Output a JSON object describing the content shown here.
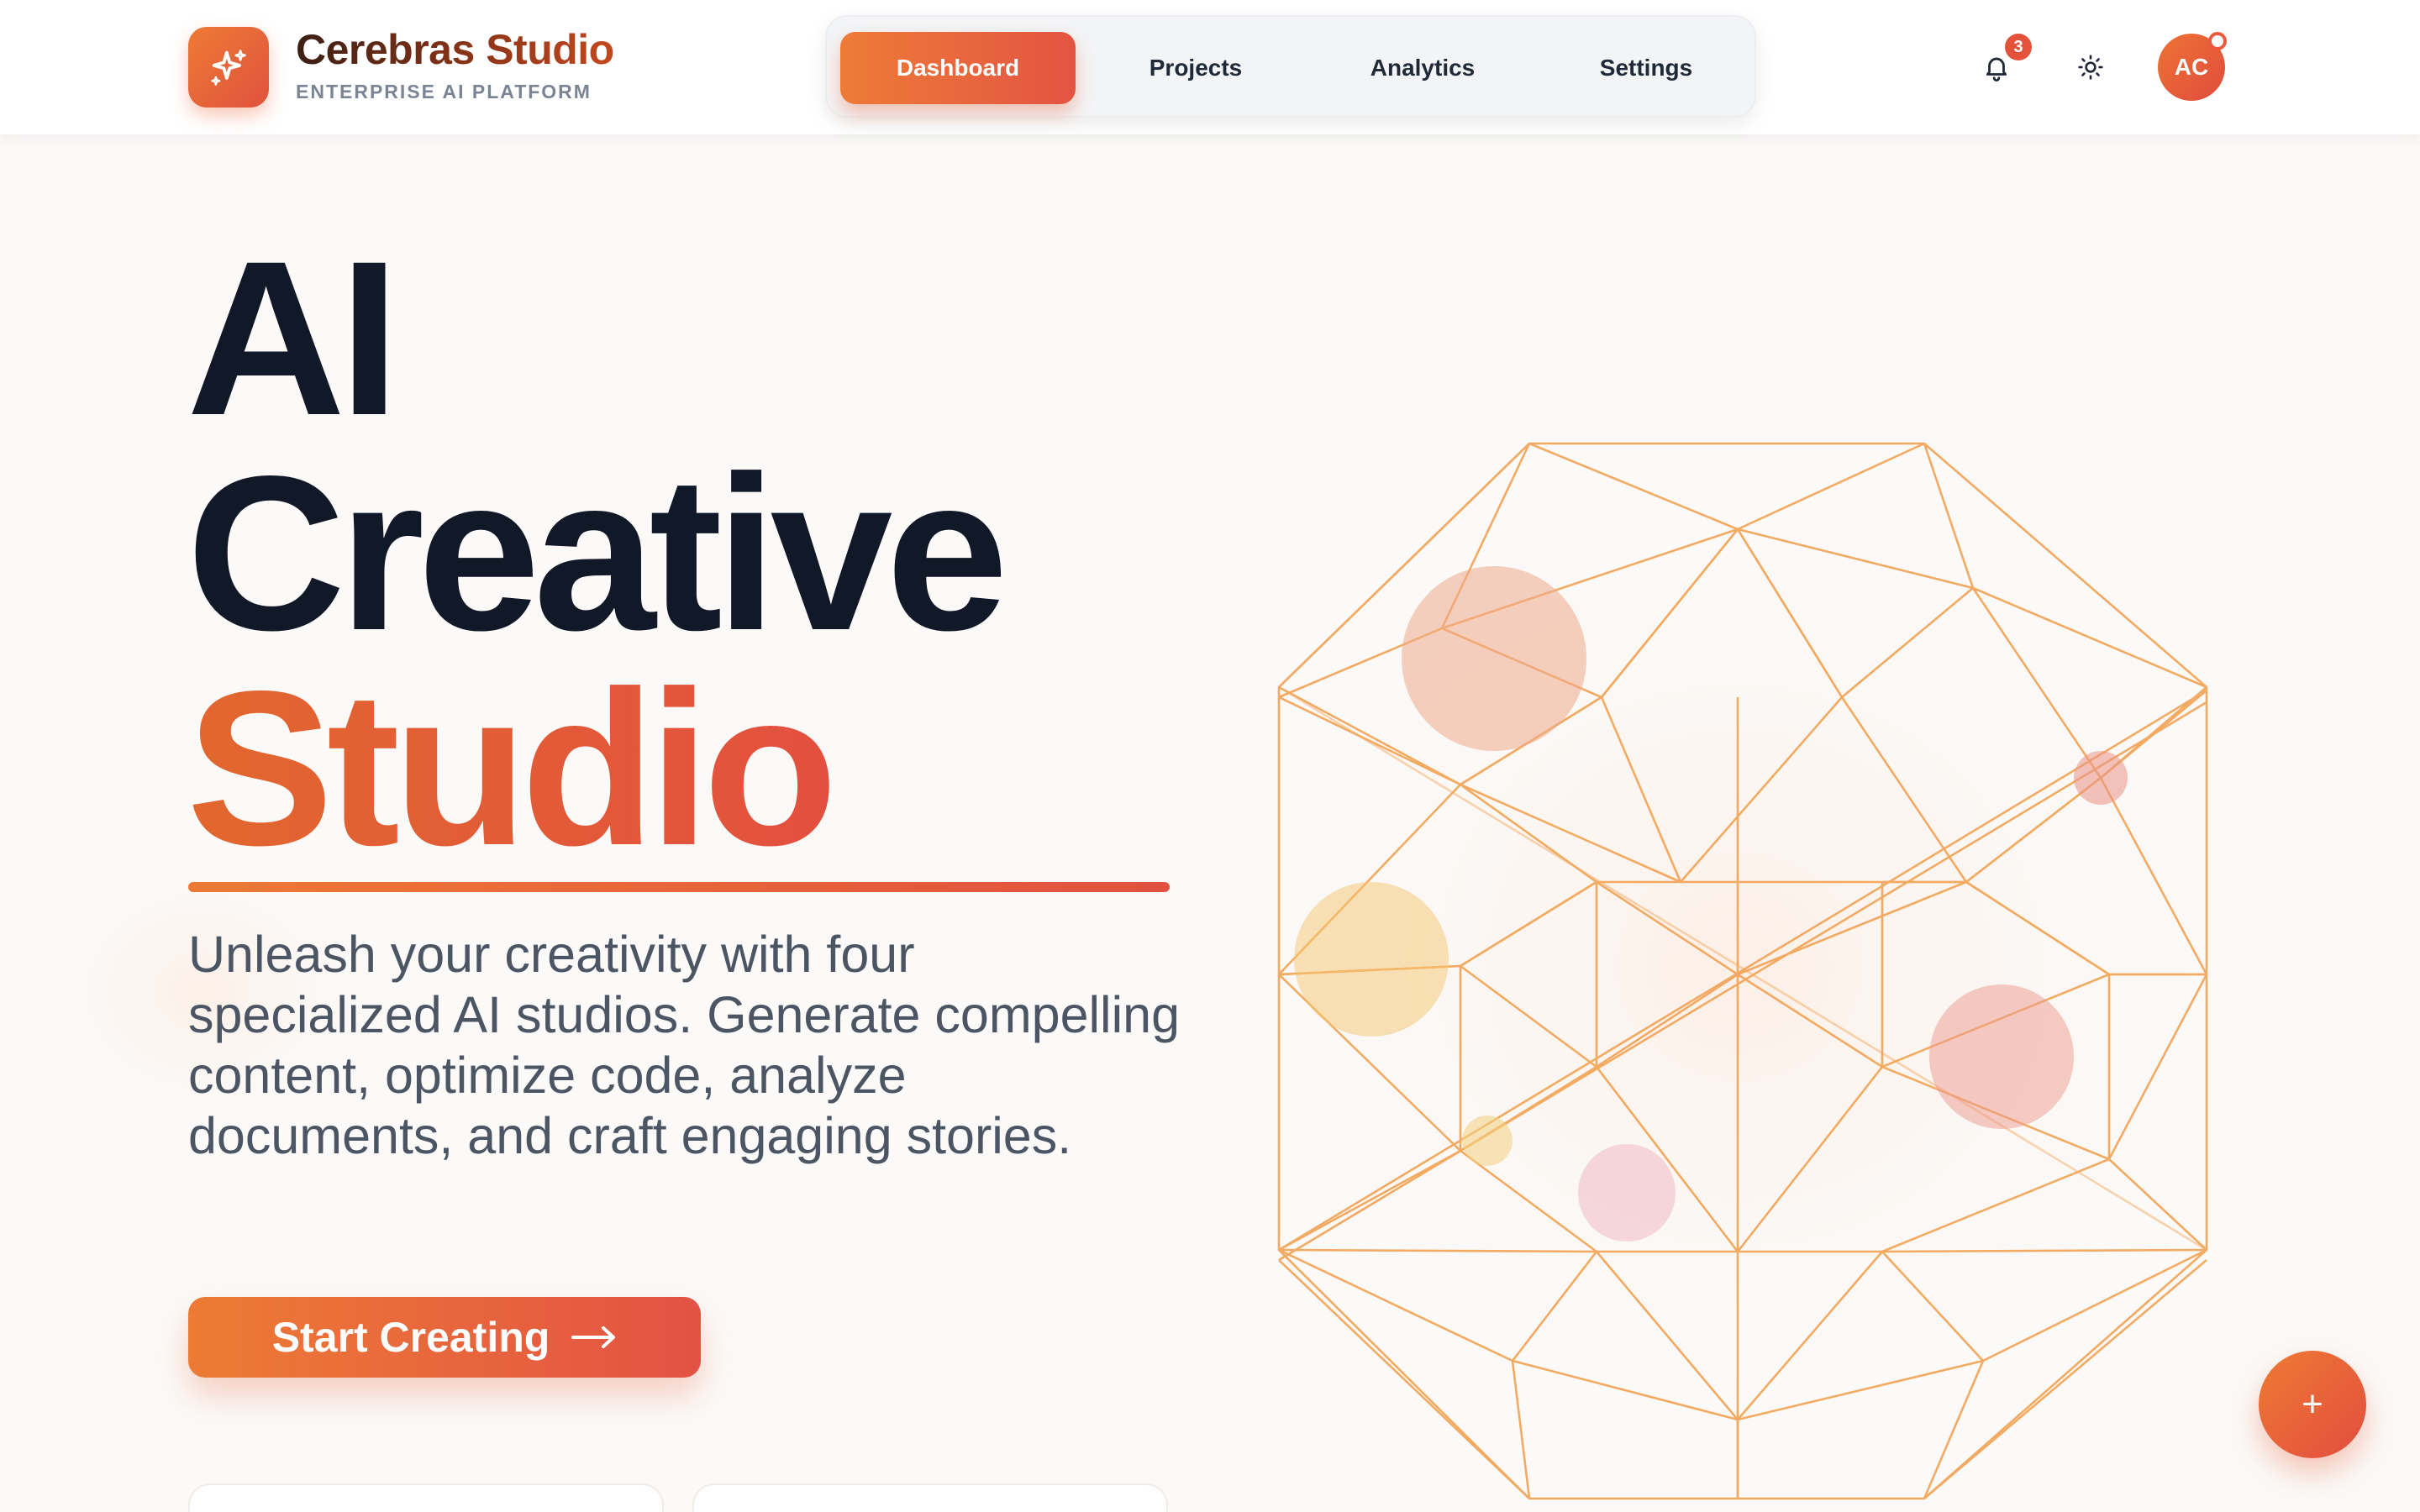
{
  "brand": {
    "name": "Cerebras Studio",
    "tagline": "ENTERPRISE AI PLATFORM",
    "logo_icon": "sparkles-icon"
  },
  "nav": {
    "items": [
      {
        "label": "Dashboard",
        "active": true
      },
      {
        "label": "Projects",
        "active": false
      },
      {
        "label": "Analytics",
        "active": false
      },
      {
        "label": "Settings",
        "active": false
      }
    ]
  },
  "header_actions": {
    "notifications_icon": "bell-icon",
    "notification_count": "3",
    "theme_icon": "sun-icon",
    "avatar_initials": "AC"
  },
  "hero": {
    "title_line1": "AI",
    "title_line2": "Creative",
    "title_line3": "Studio",
    "description": "Unleash your creativity with four specialized AI studios. Generate compelling content, optimize code, analyze documents, and craft engaging stories.",
    "cta_label": "Start Creating",
    "cta_icon": "arrow-right-icon"
  },
  "fab": {
    "label": "+",
    "icon": "plus-icon"
  },
  "colors": {
    "accent_start": "#ed7a35",
    "accent_end": "#e2503f",
    "text_dark": "#111827",
    "text_muted": "#4b5563",
    "wireframe": "#f3a65a"
  }
}
